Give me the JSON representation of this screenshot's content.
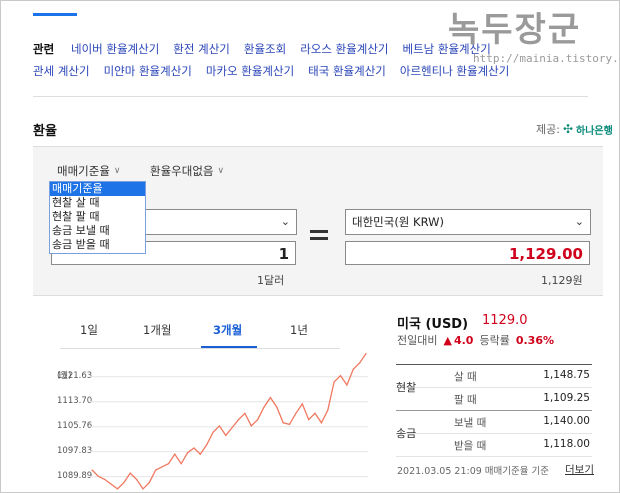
{
  "watermark": {
    "text": "녹두장군",
    "url": "http://mainia.tistory.com"
  },
  "related": {
    "label": "관련",
    "row1": [
      "네이버 환율계산기",
      "환전 계산기",
      "환율조회",
      "라오스 환율계산기",
      "베트남 환율계산기"
    ],
    "row2": [
      "관세 계산기",
      "미얀마 환율계산기",
      "마카오 환율계산기",
      "태국 환율계산기",
      "아르헨티나 환율계산기"
    ]
  },
  "section": {
    "title": "환율",
    "provider_label": "제공:",
    "provider_name": "하나은행"
  },
  "options": {
    "rate_type": "매매기준율",
    "preferential": "환율우대없음"
  },
  "dropdown_items": [
    "매매기준율",
    "현찰 살 때",
    "현찰 팔 때",
    "송금 보낼 때",
    "송금 받을 때"
  ],
  "converter": {
    "from_value": "1",
    "from_unit": "1달러",
    "to_currency": "대한민국(원 KRW)",
    "to_value": "1,129.00",
    "to_unit": "1,129원"
  },
  "period_tabs": [
    "1일",
    "1개월",
    "3개월",
    "1년"
  ],
  "active_tab": "3개월",
  "chart_data": {
    "type": "line",
    "ylabel": "(원)",
    "y_ticks": [
      "1121.63",
      "1113.70",
      "1105.76",
      "1097.83",
      "1089.89"
    ],
    "ylim": [
      1085,
      1129.5
    ],
    "series": [
      {
        "values": [
          1092.0,
          1090.0,
          1089.0,
          1087.5,
          1086.0,
          1088.0,
          1091.0,
          1089.0,
          1086.0,
          1088.0,
          1092.0,
          1093.0,
          1094.0,
          1097.0,
          1094.0,
          1097.5,
          1099.0,
          1097.0,
          1100.0,
          1104.0,
          1106.0,
          1103.0,
          1105.5,
          1108.0,
          1110.0,
          1106.0,
          1108.0,
          1112.0,
          1115.0,
          1112.0,
          1107.0,
          1106.5,
          1110.0,
          1113.0,
          1108.0,
          1110.0,
          1107.0,
          1111.0,
          1120.0,
          1122.0,
          1119.0,
          1124.0,
          1126.0,
          1129.0
        ]
      }
    ]
  },
  "currency": {
    "title": "미국 (USD)",
    "price": "1129.0",
    "change_label": "전일대비",
    "change_arrow": "▲",
    "change_value": "4.0",
    "rate_label": "등락률",
    "rate_value": "0.36%"
  },
  "rates": {
    "cash_label": "현찰",
    "remit_label": "송금",
    "cash_buy_label": "살 때",
    "cash_buy": "1,148.75",
    "cash_sell_label": "팔 때",
    "cash_sell": "1,109.25",
    "send_label": "보낼 때",
    "send": "1,140.00",
    "receive_label": "받을 때",
    "receive": "1,118.00"
  },
  "footer": {
    "text": "2021.03.05 21:09 매매기준율 기준",
    "more": "더보기"
  }
}
